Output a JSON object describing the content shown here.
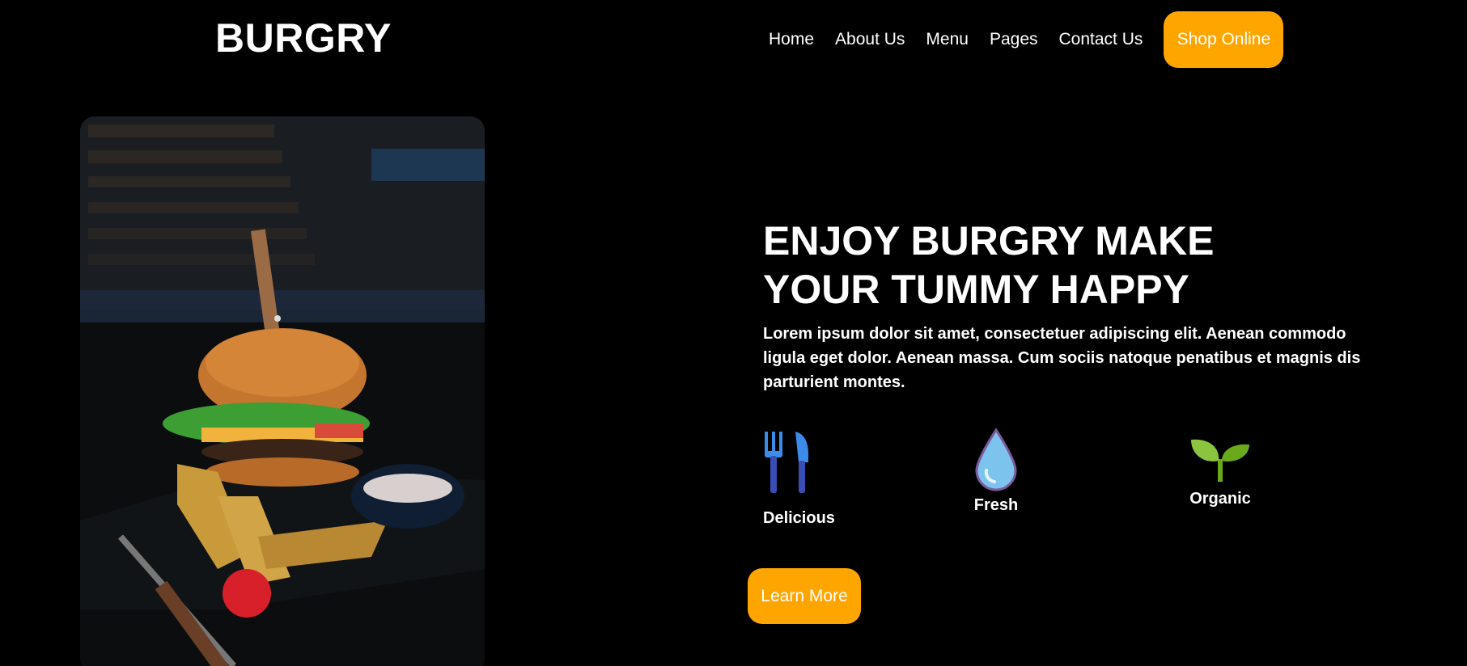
{
  "header": {
    "logo": "BURGRY",
    "nav": [
      "Home",
      "About Us",
      "Menu",
      "Pages",
      "Contact Us"
    ],
    "cta": "Shop Online"
  },
  "hero": {
    "headline_line1": "ENJOY BURGRY MAKE",
    "headline_line2": "YOUR TUMMY HAPPY",
    "description": "Lorem ipsum dolor sit amet, consectetuer adipiscing elit. Aenean commodo ligula eget dolor. Aenean massa. Cum sociis natoque penatibus et magnis dis parturient montes.",
    "features": [
      {
        "icon": "fork-knife-icon",
        "label": "Delicious"
      },
      {
        "icon": "water-drop-icon",
        "label": "Fresh"
      },
      {
        "icon": "sprout-icon",
        "label": "Organic"
      }
    ],
    "cta": "Learn More"
  },
  "colors": {
    "accent": "#ffa500",
    "background": "#000000",
    "text": "#ffffff"
  }
}
